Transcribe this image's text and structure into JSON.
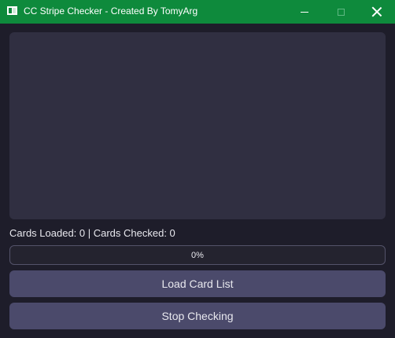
{
  "window": {
    "title": "CC Stripe Checker - Created By TomyArg",
    "titlebar_color": "#0e8a3c",
    "background_color": "#1e1d2a"
  },
  "controls": {
    "minimize_icon": "minimize-icon",
    "maximize_icon": "maximize-icon",
    "close_icon": "close-icon"
  },
  "output": {
    "text": ""
  },
  "status": {
    "text": "Cards Loaded: 0 | Cards Checked: 0"
  },
  "progress": {
    "value": 0,
    "label": "0%"
  },
  "buttons": {
    "load_label": "Load Card List",
    "stop_label": "Stop Checking",
    "color": "#4b4a6b"
  }
}
